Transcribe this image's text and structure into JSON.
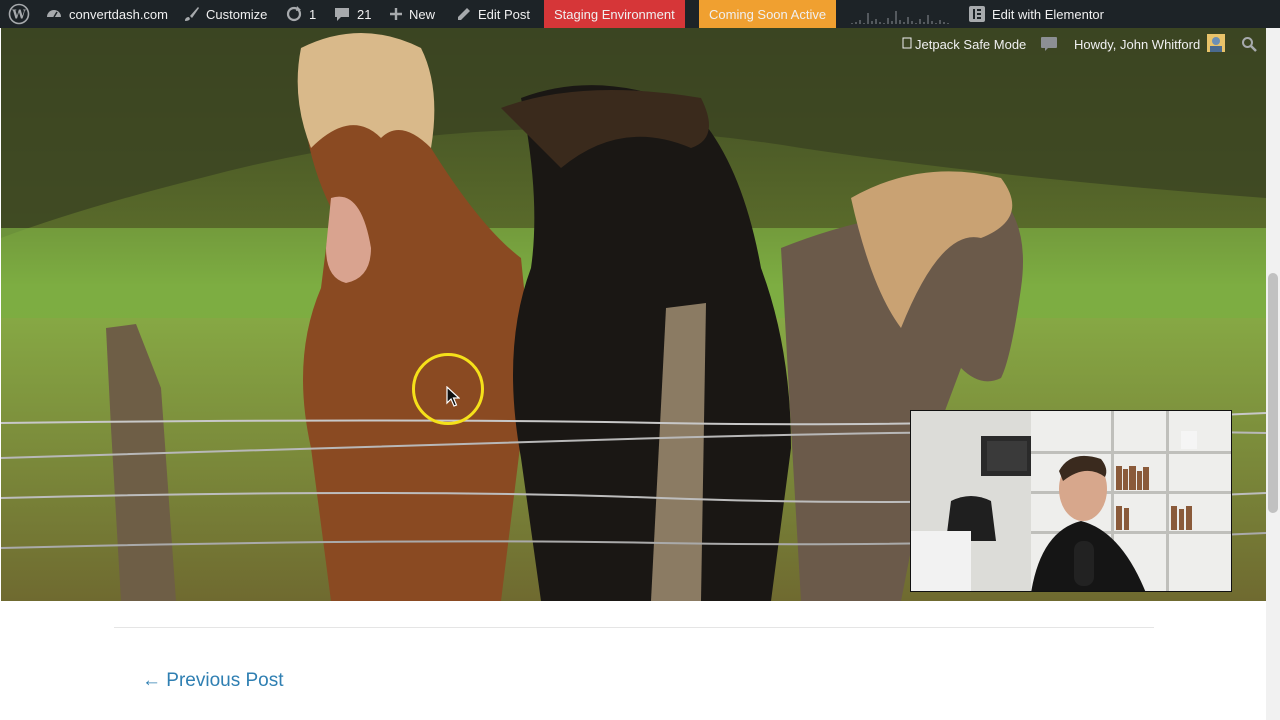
{
  "adminbar": {
    "site_name": "convertdash.com",
    "customize": "Customize",
    "updates_count": "1",
    "comments_count": "21",
    "new_label": "New",
    "edit_post": "Edit Post",
    "staging": "Staging Environment",
    "coming_soon": "Coming Soon Active",
    "elementor": "Edit with Elementor",
    "jetpack": "Jetpack Safe Mode",
    "howdy": "Howdy, John Whitford"
  },
  "post_nav": {
    "previous": "← Previous Post"
  },
  "colors": {
    "adminbar_bg": "#1d2327",
    "staging_bg": "#d63638",
    "coming_soon_bg": "#f0a030",
    "link": "#2f7fb2",
    "cursor_ring": "#f5e11a"
  }
}
